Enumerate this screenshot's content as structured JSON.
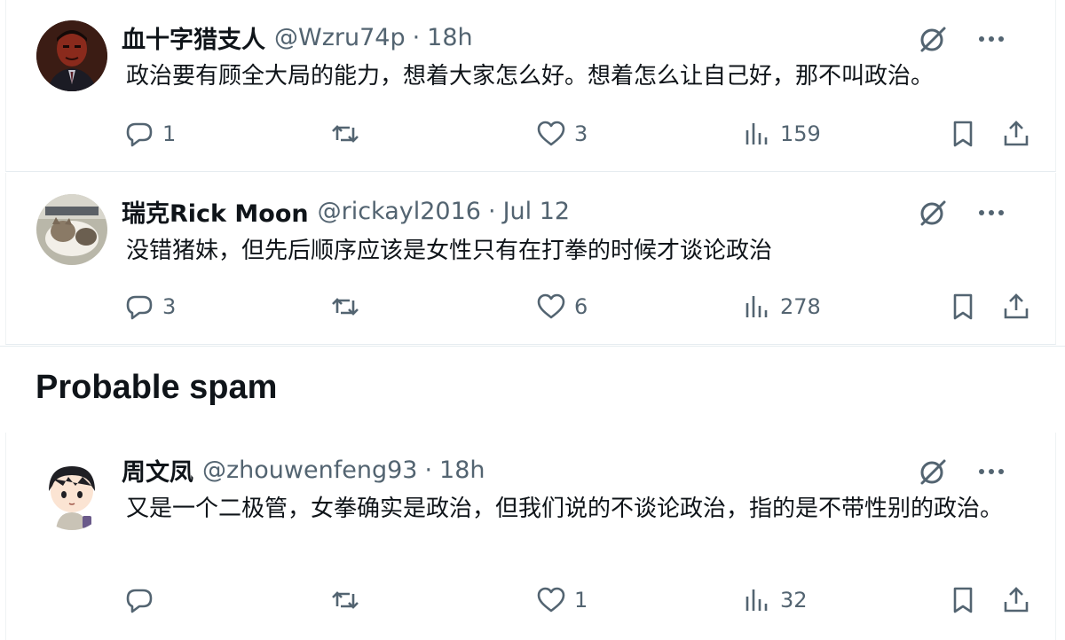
{
  "tweets": [
    {
      "display_name": "血十字猎支人",
      "handle": "@Wzru74p",
      "separator": "·",
      "time": "18h",
      "text": "政治要有顾全大局的能力，想着大家怎么好。想着怎么让自己好，那不叫政治。",
      "reply_count": "1",
      "retweet_count": "",
      "like_count": "3",
      "view_count": "159",
      "avatar_icon": "avatar-dark-portrait"
    },
    {
      "display_name": "瑞克Rick Moon",
      "handle": "@rickayl2016",
      "separator": "·",
      "time": "Jul 12",
      "text": "没错猪妹，但先后顺序应该是女性只有在打拳的时候才谈论政治",
      "reply_count": "3",
      "retweet_count": "",
      "like_count": "6",
      "view_count": "278",
      "avatar_icon": "avatar-cat"
    },
    {
      "display_name": "周文凤",
      "handle": "@zhouwenfeng93",
      "separator": "·",
      "time": "18h",
      "text": "又是一个二极管，女拳确实是政治，但我们说的不谈论政治，指的是不带性别的政治。",
      "reply_count": "",
      "retweet_count": "",
      "like_count": "1",
      "view_count": "32",
      "avatar_icon": "avatar-cartoon-boy"
    }
  ],
  "section_title": "Probable spam",
  "colors": {
    "text_primary": "#0f1419",
    "text_secondary": "#536471",
    "border": "#eff3f4"
  },
  "icons": [
    "grok-icon",
    "more-icon",
    "reply-icon",
    "retweet-icon",
    "like-icon",
    "views-icon",
    "bookmark-icon",
    "share-icon"
  ]
}
